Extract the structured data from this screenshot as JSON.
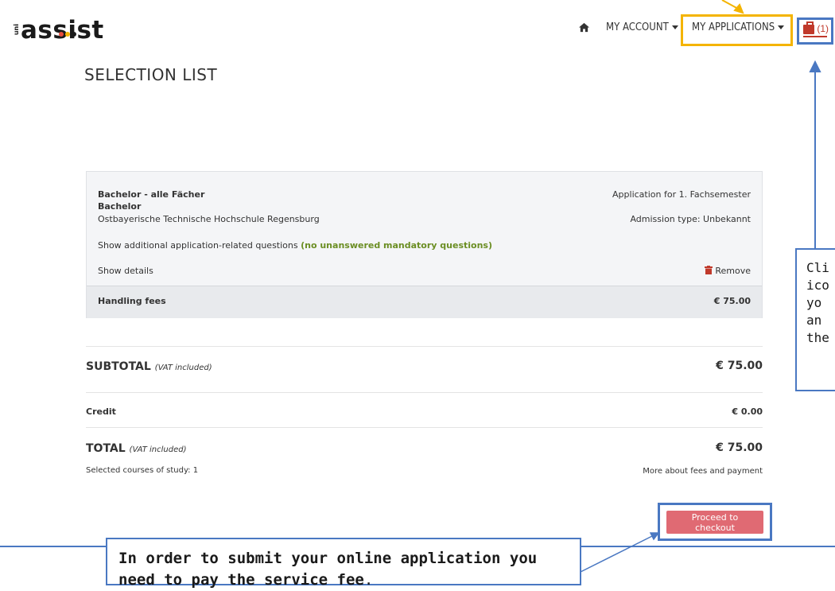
{
  "logo": {
    "prefix": "uni",
    "main": "assist",
    "dot_colors": [
      "#e74c3c",
      "#f4b400",
      "#1a1a1a"
    ]
  },
  "nav": {
    "my_account": "MY ACCOUNT",
    "my_applications": "MY APPLICATIONS",
    "cart_count": "(1)"
  },
  "page_title": "SELECTION LIST",
  "application": {
    "program": "Bachelor - alle Fächer",
    "degree": "Bachelor",
    "university": "Ostbayerische Technische Hochschule Regensburg",
    "application_for": "Application for 1. Fachsemester",
    "admission_type": "Admission type: Unbekannt",
    "questions_link": "Show additional application-related questions",
    "questions_status": "(no unanswered mandatory questions)",
    "show_details": "Show details",
    "remove": "Remove",
    "fees_label": "Handling fees",
    "fees_value": "€ 75.00"
  },
  "summary": {
    "subtotal_label": "SUBTOTAL",
    "subtotal_note": "(VAT included)",
    "subtotal_value": "€ 75.00",
    "credit_label": "Credit",
    "credit_value": "€ 0.00",
    "total_label": "TOTAL",
    "total_note": "(VAT included)",
    "total_value": "€ 75.00",
    "courses": "Selected courses of study: 1",
    "fees_link": "More about fees and payment",
    "checkout": "Proceed to checkout"
  },
  "callouts": {
    "right_lines": [
      "Cli",
      "ico",
      "yo",
      "an",
      "the"
    ],
    "bottom_bold": "In order to submit your online application you need to pay the service fee",
    "bottom_end": "."
  },
  "colors": {
    "accent_blue": "#4a78c2",
    "highlight_yellow": "#f4b400",
    "checkout": "#e06a73",
    "remove_red": "#c0392b"
  }
}
